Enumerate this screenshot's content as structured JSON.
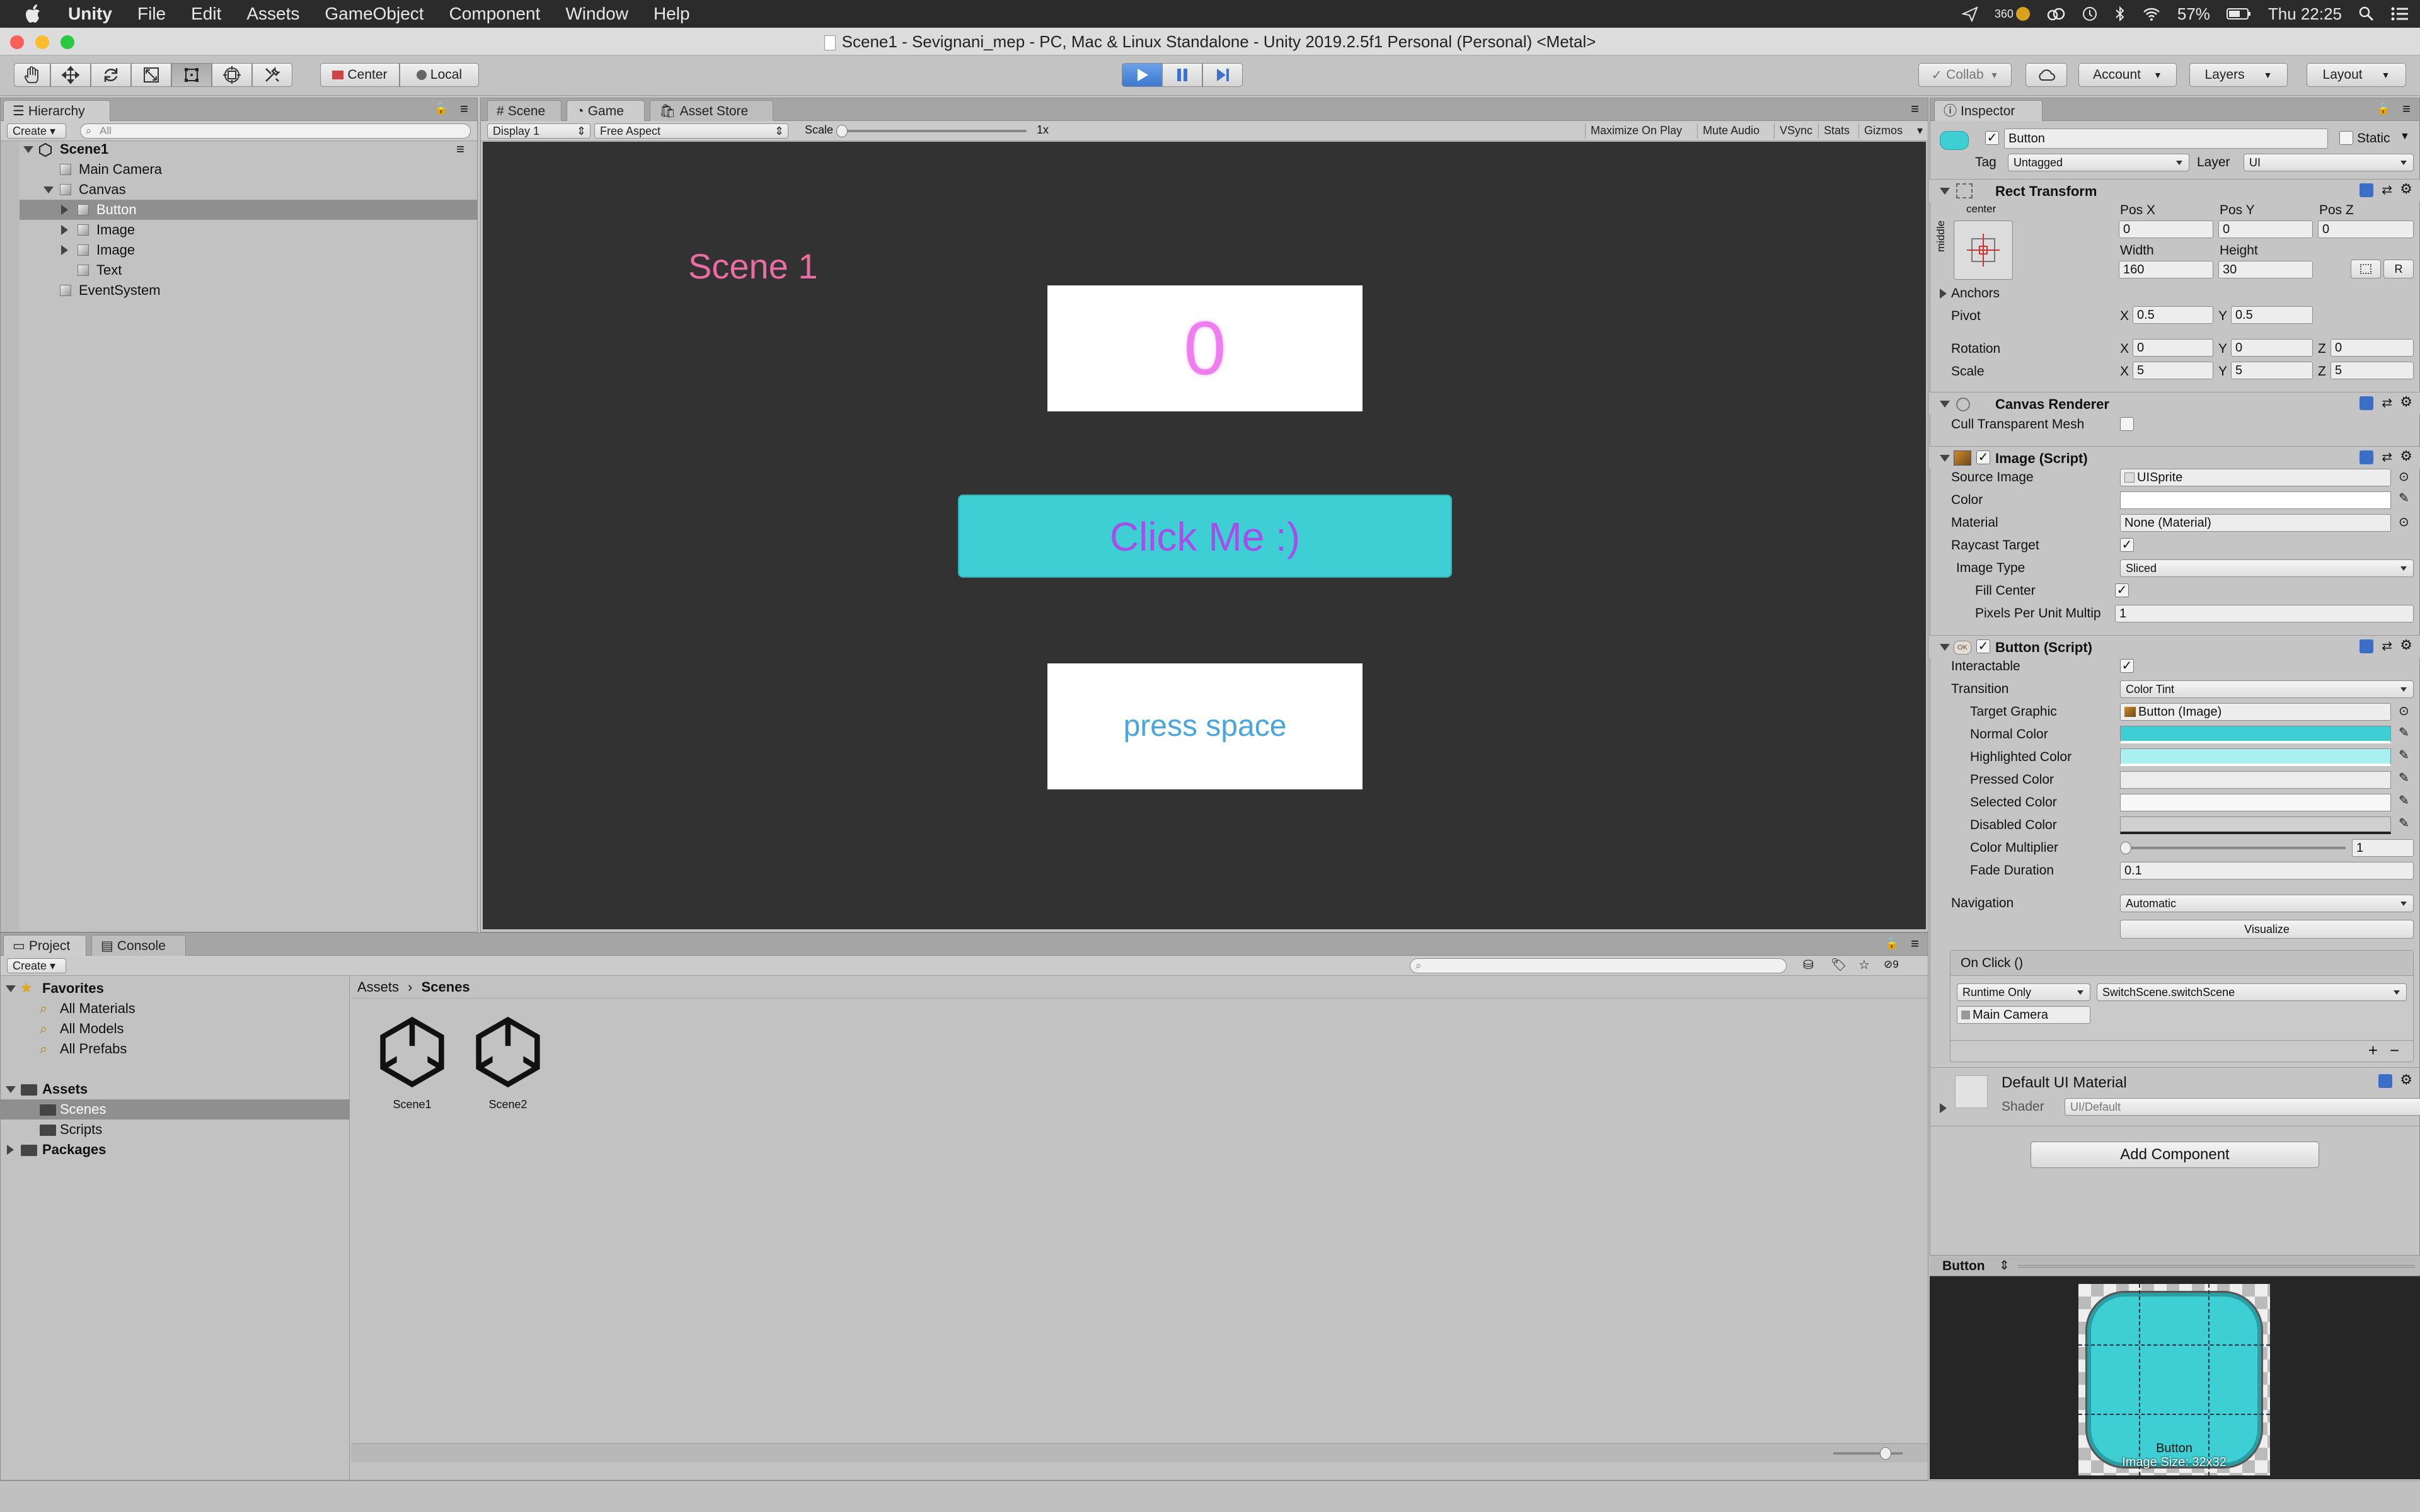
{
  "menubar": {
    "app": "Unity",
    "items": [
      "File",
      "Edit",
      "Assets",
      "GameObject",
      "Component",
      "Window",
      "Help"
    ],
    "battery": "57%",
    "clock": "Thu 22:25",
    "temp": "360"
  },
  "window": {
    "title": "Scene1 - Sevignani_mep - PC, Mac & Linux Standalone - Unity 2019.2.5f1 Personal (Personal) <Metal>"
  },
  "toolbar": {
    "center": "Center",
    "local": "Local",
    "collab": "Collab",
    "account": "Account",
    "layers": "Layers",
    "layout": "Layout"
  },
  "hierarchy": {
    "tab": "Hierarchy",
    "create": "Create",
    "search_placeholder": "All",
    "scene": "Scene1",
    "items": [
      "Main Camera",
      "Canvas",
      "Button",
      "Image",
      "Image",
      "Text",
      "EventSystem"
    ]
  },
  "tabs": {
    "scene": "Scene",
    "game": "Game",
    "asset_store": "Asset Store"
  },
  "game": {
    "display": "Display 1",
    "aspect": "Free Aspect",
    "scale_label": "Scale",
    "scale_value": "1x",
    "maximize": "Maximize On Play",
    "mute": "Mute Audio",
    "vsync": "VSync",
    "stats": "Stats",
    "gizmos": "Gizmos",
    "scene_text": "Scene 1",
    "counter": "0",
    "button": "Click Me :)",
    "press": "press space"
  },
  "inspector": {
    "tab": "Inspector",
    "name": "Button",
    "static": "Static",
    "tag_label": "Tag",
    "tag": "Untagged",
    "layer_label": "Layer",
    "layer": "UI",
    "rect": {
      "title": "Rect Transform",
      "anchor_h": "center",
      "anchor_v": "middle",
      "posx_l": "Pos X",
      "posy_l": "Pos Y",
      "posz_l": "Pos Z",
      "posx": "0",
      "posy": "0",
      "posz": "0",
      "width_l": "Width",
      "height_l": "Height",
      "width": "160",
      "height": "30",
      "r": "R",
      "anchors": "Anchors",
      "pivot": "Pivot",
      "pivot_x": "0.5",
      "pivot_y": "0.5",
      "rotation": "Rotation",
      "rot_x": "0",
      "rot_y": "0",
      "rot_z": "0",
      "scale": "Scale",
      "sc_x": "5",
      "sc_y": "5",
      "sc_z": "5",
      "x": "X",
      "y": "Y",
      "z": "Z"
    },
    "canvas_renderer": {
      "title": "Canvas Renderer",
      "cull": "Cull Transparent Mesh"
    },
    "image": {
      "title": "Image (Script)",
      "source_l": "Source Image",
      "source": "UISprite",
      "color_l": "Color",
      "material_l": "Material",
      "material": "None (Material)",
      "raycast_l": "Raycast Target",
      "type_l": "Image Type",
      "type": "Sliced",
      "fill_l": "Fill Center",
      "ppu_l": "Pixels Per Unit Multip",
      "ppu": "1"
    },
    "button": {
      "title": "Button (Script)",
      "interactable": "Interactable",
      "transition_l": "Transition",
      "transition": "Color Tint",
      "target_l": "Target Graphic",
      "target": "Button (Image)",
      "normal": "Normal Color",
      "highlighted": "Highlighted Color",
      "pressed": "Pressed Color",
      "selected": "Selected Color",
      "disabled": "Disabled Color",
      "multiplier_l": "Color Multiplier",
      "multiplier": "1",
      "fade_l": "Fade Duration",
      "fade": "0.1",
      "navigation_l": "Navigation",
      "navigation": "Automatic",
      "visualize": "Visualize",
      "onclick": "On Click ()",
      "runtime": "Runtime Only",
      "function": "SwitchScene.switchScene",
      "object": "Main Camera"
    },
    "material": {
      "title": "Default UI Material",
      "shader_l": "Shader",
      "shader": "UI/Default"
    },
    "add_component": "Add Component"
  },
  "preview": {
    "title": "Button",
    "caption": "Button",
    "size": "Image Size: 32x32"
  },
  "project": {
    "tab": "Project",
    "console": "Console",
    "create": "Create",
    "badge": "9",
    "favorites": "Favorites",
    "fav_items": [
      "All Materials",
      "All Models",
      "All Prefabs"
    ],
    "assets": "Assets",
    "asset_items": [
      "Scenes",
      "Scripts"
    ],
    "packages": "Packages",
    "breadcrumb_root": "Assets",
    "breadcrumb_leaf": "Scenes",
    "files": [
      "Scene1",
      "Scene2"
    ]
  },
  "colors": {
    "accent_teal": "#3ecfd4",
    "counter_pink": "#f07df0",
    "scene_pink": "#e86da0",
    "button_text": "#a54ee8",
    "press_blue": "#4aa6de",
    "selection": "#8f8f8f"
  }
}
